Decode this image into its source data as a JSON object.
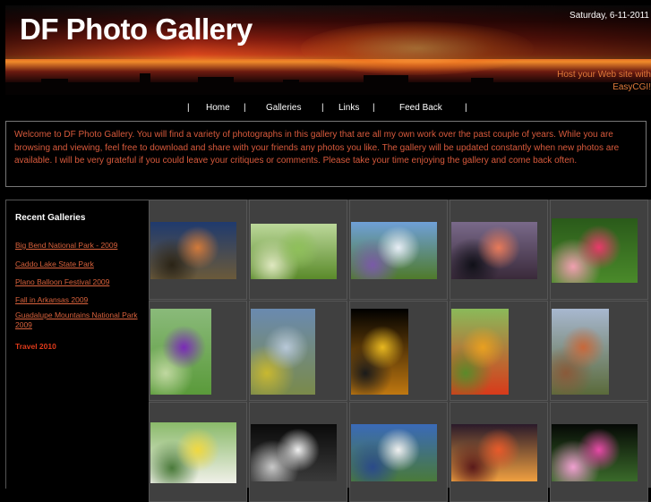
{
  "header": {
    "title": "DF Photo Gallery",
    "date": "Saturday, 6-11-2011",
    "host_line1": "Host your Web site with",
    "host_line2": "EasyCGI!"
  },
  "nav": {
    "sep": "|",
    "home": "Home",
    "galleries": "Galleries",
    "links": "Links",
    "feedback": "Feed Back"
  },
  "welcome": {
    "text": "Welcome to DF Photo Gallery. You will find a variety of photographs in this gallery that are all my own work over the past couple of years. While you are browsing and viewing, feel free to download and share with your friends any photos you like. The gallery will be updated constantly when new photos are available. I will be very grateful if you could leave your critiques or comments. Please take your time enjoying the gallery and come back often."
  },
  "sidebar": {
    "heading": "Recent Galleries",
    "items": [
      "Big Bend National Park - 2009",
      "Caddo Lake State Park",
      "Plano Balloon Festival 2009",
      "Fall in Arkansas 2009",
      "Guadalupe Mountains National Park 2009"
    ],
    "travel": "Travel 2010"
  },
  "thumbnails": [
    {
      "name": "sunset-grassland-thumb",
      "colors": [
        "#1f3a6e",
        "#d27a3a",
        "#6b5a3a",
        "#2b2416"
      ]
    },
    {
      "name": "green-leaves-thumb",
      "colors": [
        "#bcd89a",
        "#8fc05a",
        "#5a8a2a",
        "#dfe8c0"
      ]
    },
    {
      "name": "wildflower-field-thumb",
      "colors": [
        "#6fa0d8",
        "#e8eef6",
        "#4f7a2a",
        "#7a5aa8"
      ]
    },
    {
      "name": "lake-sunset-thumb",
      "colors": [
        "#7a6a8a",
        "#e87a5a",
        "#3a2a3a",
        "#101018"
      ]
    },
    {
      "name": "pink-flower-thumb",
      "colors": [
        "#2a5a1a",
        "#e83a6a",
        "#4a8a2a",
        "#f0a0b0"
      ]
    },
    {
      "name": "purple-flower-thumb",
      "colors": [
        "#8aba7a",
        "#7a2ab8",
        "#5a9a3a",
        "#c0d8a0"
      ]
    },
    {
      "name": "prairie-sky-thumb",
      "colors": [
        "#6a8ab0",
        "#b8c8d8",
        "#7a8a4a",
        "#c8b830"
      ]
    },
    {
      "name": "yellow-orchid-thumb",
      "colors": [
        "#000000",
        "#e8b820",
        "#c07810",
        "#1a1a1a"
      ]
    },
    {
      "name": "tulip-field-thumb",
      "colors": [
        "#8aba5a",
        "#e8a020",
        "#d83a1a",
        "#5a8a2a"
      ]
    },
    {
      "name": "canyon-thumb",
      "colors": [
        "#a8b8d0",
        "#c8683a",
        "#5a6a3a",
        "#8a5a3a"
      ]
    },
    {
      "name": "butterfly-thumb",
      "colors": [
        "#8aba6a",
        "#f0d840",
        "#f0f0e8",
        "#4a7a3a"
      ]
    },
    {
      "name": "spider-lily-thumb",
      "colors": [
        "#0a0a0a",
        "#f0f0f0",
        "#3a3a3a",
        "#c8c8c8"
      ]
    },
    {
      "name": "cloud-landscape-thumb",
      "colors": [
        "#3a6ab8",
        "#f0f0f0",
        "#4a7a3a",
        "#2a4a8a"
      ]
    },
    {
      "name": "red-sunset-thumb",
      "colors": [
        "#2a1a2a",
        "#e85a2a",
        "#f0a040",
        "#5a1a1a"
      ]
    },
    {
      "name": "pink-flowers-dark-thumb",
      "colors": [
        "#050805",
        "#e84aa8",
        "#3a6a2a",
        "#f0a0d0"
      ]
    }
  ]
}
